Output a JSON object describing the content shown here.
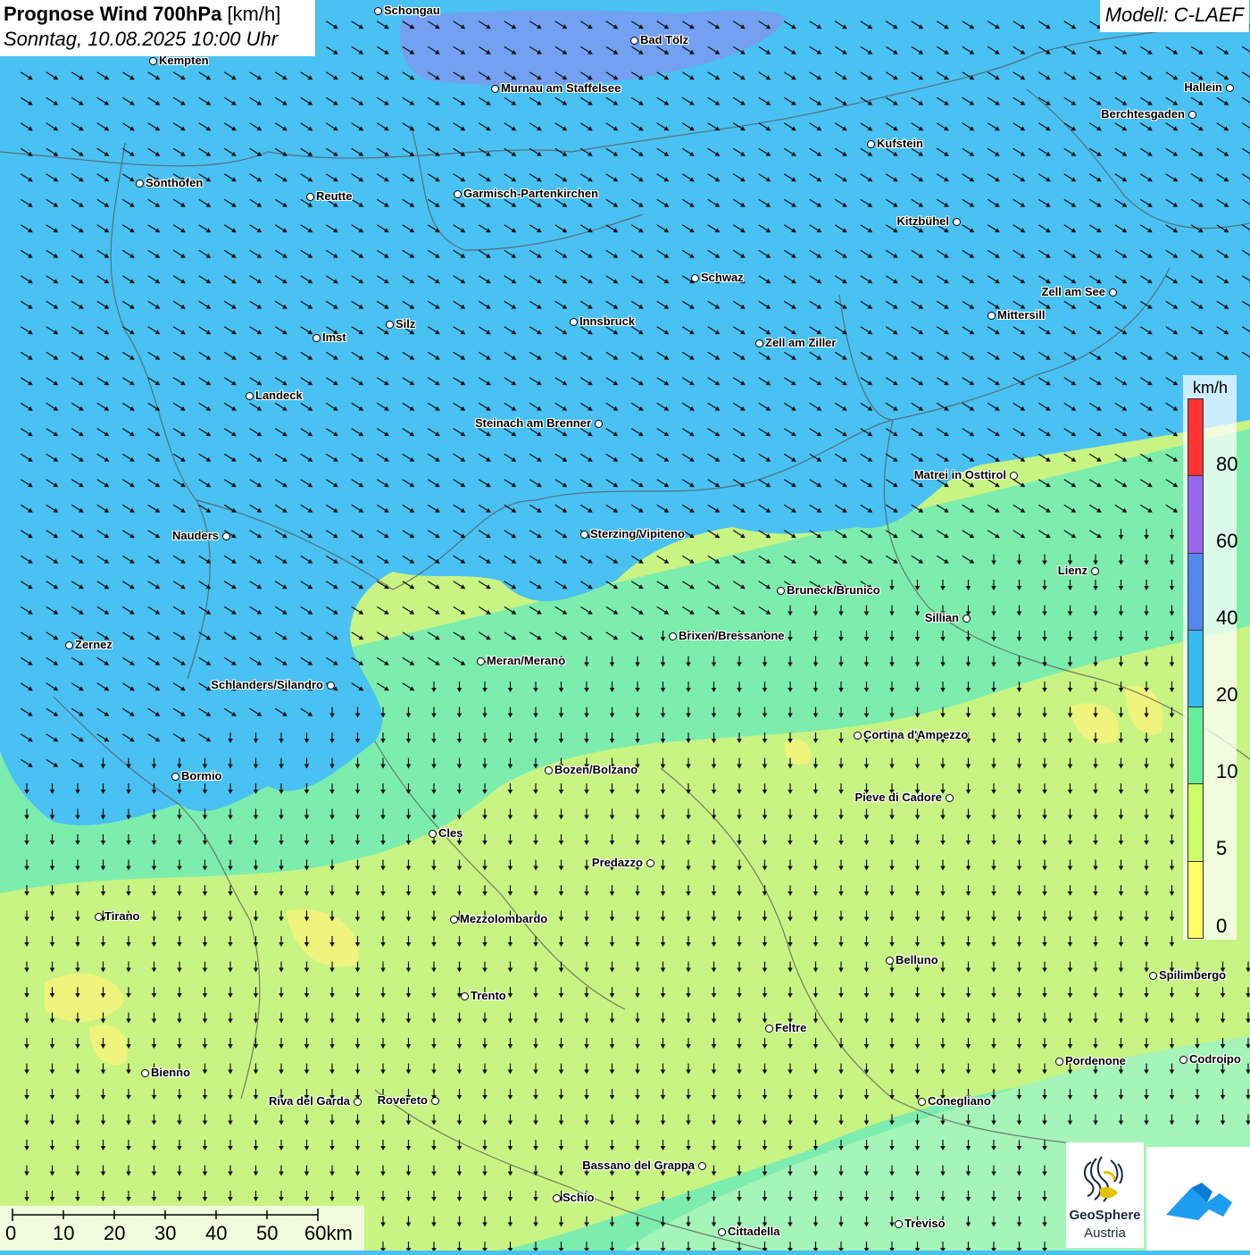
{
  "title": {
    "main": "Prognose Wind 700hPa",
    "unit": "[km/h]",
    "datetime": "Sonntag, 10.08.2025 10:00 Uhr"
  },
  "model": "Modell: C-LAEF",
  "legend": {
    "unit": "km/h",
    "ticks": [
      "80",
      "60",
      "40",
      "20",
      "10",
      "5",
      "0"
    ],
    "bands": [
      {
        "from": 0,
        "to": 5,
        "color": "#ffff66"
      },
      {
        "from": 5,
        "to": 10,
        "color": "#ccff66"
      },
      {
        "from": 10,
        "to": 20,
        "color": "#66ee99"
      },
      {
        "from": 20,
        "to": 40,
        "color": "#33bbee"
      },
      {
        "from": 40,
        "to": 60,
        "color": "#5588ee"
      },
      {
        "from": 60,
        "to": 80,
        "color": "#9966ee"
      },
      {
        "from": 80,
        "to": 100,
        "color": "#ff3333"
      }
    ]
  },
  "field_colors": {
    "blue": "#49c1f2",
    "strong_blue": "#7a9af0",
    "green": "#7dedae",
    "lime": "#c8f484",
    "yellow": "#eef47c"
  },
  "wind": {
    "north_direction": "southeast",
    "south_direction": "south"
  },
  "scale_bar": {
    "labels": [
      "0",
      "10",
      "20",
      "30",
      "40",
      "50",
      "60km"
    ]
  },
  "cities": [
    {
      "name": "Schongau",
      "side": "right"
    },
    {
      "name": "Bad Tölz",
      "side": "right"
    },
    {
      "name": "Kempten",
      "side": "right"
    },
    {
      "name": "Murnau am Staffelsee",
      "side": "right"
    },
    {
      "name": "Hallein",
      "side": "left"
    },
    {
      "name": "Berchtesgaden",
      "side": "left"
    },
    {
      "name": "Kufstein",
      "side": "right"
    },
    {
      "name": "Sonthofen",
      "side": "right"
    },
    {
      "name": "Reutte",
      "side": "right"
    },
    {
      "name": "Garmisch-Partenkirchen",
      "side": "right"
    },
    {
      "name": "Kitzbühel",
      "side": "left"
    },
    {
      "name": "Schwaz",
      "side": "right"
    },
    {
      "name": "Zell am See",
      "side": "left"
    },
    {
      "name": "Mittersill",
      "side": "right"
    },
    {
      "name": "Innsbruck",
      "side": "right"
    },
    {
      "name": "Silz",
      "side": "right"
    },
    {
      "name": "Imst",
      "side": "right"
    },
    {
      "name": "Zell am Ziller",
      "side": "right"
    },
    {
      "name": "Landeck",
      "side": "right"
    },
    {
      "name": "Steinach am Brenner",
      "side": "left"
    },
    {
      "name": "Matrei in Osttirol",
      "side": "left"
    },
    {
      "name": "Nauders",
      "side": "left"
    },
    {
      "name": "Sterzing/Vipiteno",
      "side": "right"
    },
    {
      "name": "Lienz",
      "side": "left"
    },
    {
      "name": "Bruneck/Brunico",
      "side": "right"
    },
    {
      "name": "Sillian",
      "side": "left"
    },
    {
      "name": "Zernez",
      "side": "right"
    },
    {
      "name": "Brixen/Bressanone",
      "side": "right"
    },
    {
      "name": "Meran/Merano",
      "side": "right"
    },
    {
      "name": "Schlanders/Silandro",
      "side": "left"
    },
    {
      "name": "Cortina d'Ampezzo",
      "side": "right"
    },
    {
      "name": "Bozen/Bolzano",
      "side": "right"
    },
    {
      "name": "Bormio",
      "side": "right"
    },
    {
      "name": "Pieve di Cadore",
      "side": "left"
    },
    {
      "name": "Cles",
      "side": "right"
    },
    {
      "name": "Predazzo",
      "side": "left"
    },
    {
      "name": "Tirano",
      "side": "right"
    },
    {
      "name": "Mezzolombardo",
      "side": "right"
    },
    {
      "name": "Belluno",
      "side": "right"
    },
    {
      "name": "Spilimbergo",
      "side": "right"
    },
    {
      "name": "Trento",
      "side": "right"
    },
    {
      "name": "Feltre",
      "side": "right"
    },
    {
      "name": "Pordenone",
      "side": "right"
    },
    {
      "name": "Codroipo",
      "side": "right"
    },
    {
      "name": "Bienno",
      "side": "right"
    },
    {
      "name": "Riva del Garda",
      "side": "left"
    },
    {
      "name": "Rovereto",
      "side": "left"
    },
    {
      "name": "Conegliano",
      "side": "right"
    },
    {
      "name": "Bassano del Grappa",
      "side": "left"
    },
    {
      "name": "Schio",
      "side": "right"
    },
    {
      "name": "Treviso",
      "side": "right"
    },
    {
      "name": "Cittadella",
      "side": "right"
    }
  ],
  "logos": {
    "geosphere_line1": "GeoSphere",
    "geosphere_line2": "Austria"
  }
}
